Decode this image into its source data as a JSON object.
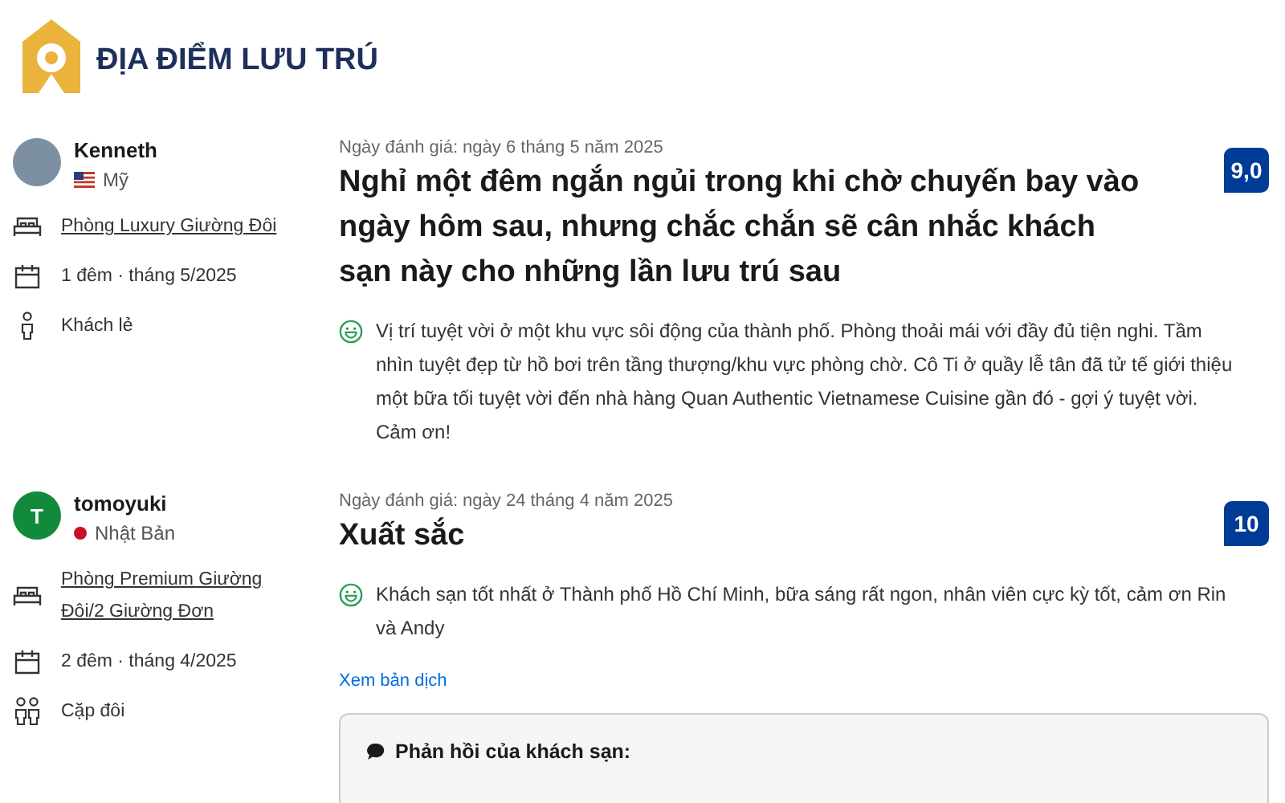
{
  "header": {
    "title": "ĐỊA ĐIỂM LƯU TRÚ"
  },
  "reviews": [
    {
      "reviewer": {
        "name": "Kenneth",
        "avatar": {
          "kind": "photo"
        },
        "country": "Mỹ",
        "flag": {
          "kind": "stripes"
        }
      },
      "meta": [
        {
          "kind": "bed",
          "text": "Phòng Luxury Giường Đôi"
        },
        {
          "kind": "calendar",
          "text": "1 đêm · tháng 5/2025"
        },
        {
          "kind": "person",
          "text": "Khách lẻ"
        }
      ],
      "date": "Ngày đánh giá: ngày 6 tháng 5 năm 2025",
      "title": "Nghỉ một đêm ngắn ngủi trong khi chờ chuyến bay vào ngày hôm sau, nhưng chắc chắn sẽ cân nhắc khách sạn này cho những lần lưu trú sau",
      "score": "9,0",
      "text": "Vị trí tuyệt vời ở một khu vực sôi động của thành phố. Phòng thoải mái với đầy đủ tiện nghi. Tầm nhìn tuyệt đẹp từ hồ bơi trên tầng thượng/khu vực phòng chờ. Cô Ti ở quầy lễ tân đã tử tế giới thiệu một bữa tối tuyệt vời đến nhà hàng Quan Authentic Vietnamese Cuisine gần đó - gợi ý tuyệt vời. Cảm ơn!"
    },
    {
      "reviewer": {
        "name": "tomoyuki",
        "avatar": {
          "kind": "initial",
          "initial": "T"
        },
        "country": "Nhật Bản",
        "flag": {
          "kind": "dot"
        }
      },
      "meta": [
        {
          "kind": "bed",
          "text": "Phòng Premium Giường Đôi/2 Giường Đơn"
        },
        {
          "kind": "calendar",
          "text": "2 đêm · tháng 4/2025"
        },
        {
          "kind": "couple",
          "text": "Cặp đôi"
        }
      ],
      "date": "Ngày đánh giá: ngày 24 tháng 4 năm 2025",
      "title": "Xuất sắc",
      "score": "10",
      "text": "Khách sạn tốt nhất ở Thành phố Hồ Chí Minh, bữa sáng rất ngon, nhân viên cực kỳ tốt, cảm ơn Rin và Andy",
      "translate": "Xem bản dịch",
      "reply": {
        "title": "Phản hồi của khách sạn:"
      }
    }
  ]
}
